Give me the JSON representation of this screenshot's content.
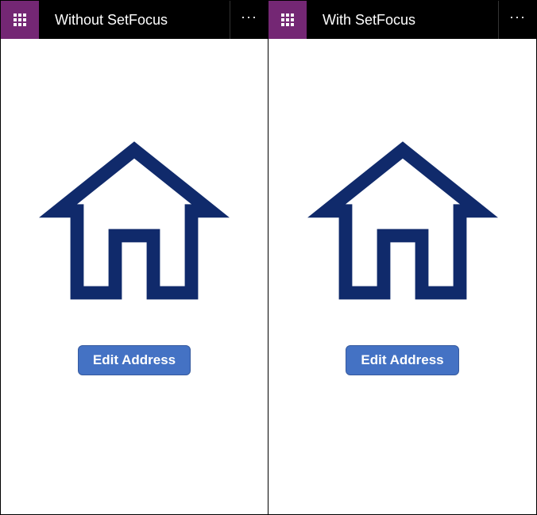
{
  "panes": [
    {
      "title": "Without SetFocus",
      "button_label": "Edit Address"
    },
    {
      "title": "With SetFocus",
      "button_label": "Edit Address"
    }
  ],
  "icons": {
    "waffle": "app-launcher-icon",
    "more": "ellipsis-icon",
    "house": "home-icon"
  },
  "colors": {
    "waffle_bg": "#742774",
    "titlebar_bg": "#000000",
    "button_bg": "#4472c4",
    "house_stroke": "#102a6b"
  }
}
